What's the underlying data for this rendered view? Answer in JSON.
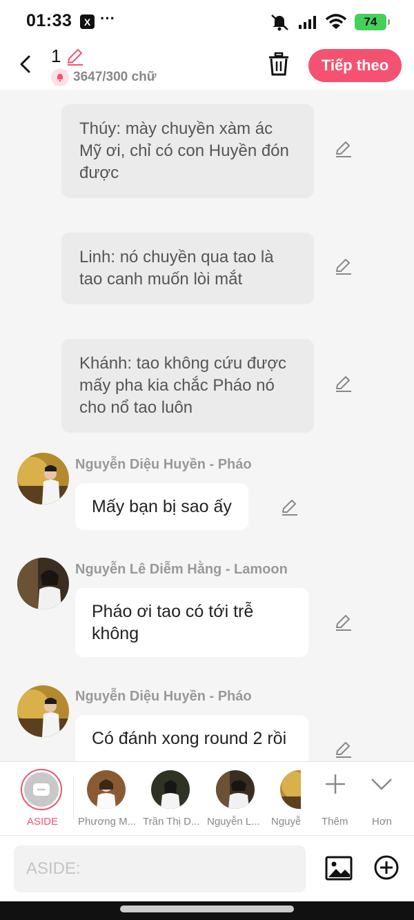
{
  "status_bar": {
    "time": "01:33",
    "x_app": "X",
    "more": "···",
    "battery": "74"
  },
  "header": {
    "title": "1",
    "word_count": "3647/300 chữ",
    "next_label": "Tiếp theo"
  },
  "messages": [
    {
      "type": "narration",
      "text": "Thúy: mày chuyền xàm ác Mỹ ơi, chỉ có con Huyền đón được"
    },
    {
      "type": "narration",
      "text": "Linh: nó chuyền qua tao là tao canh muốn lòi mắt"
    },
    {
      "type": "narration",
      "text": "Khánh: tao không cứu được mấy pha kia chắc Pháo nó cho nổ tao luôn"
    },
    {
      "type": "character",
      "sender": "Nguyễn Diệu Huyền - Pháo",
      "text": "Mấy bạn bị sao ấy"
    },
    {
      "type": "character",
      "sender": "Nguyễn Lê Diễm Hằng - Lamoon",
      "text": "Pháo ơi tao có tới trễ không"
    },
    {
      "type": "character",
      "sender": "Nguyễn Diệu Huyền - Pháo",
      "text": "Có đánh xong round 2 rồi"
    }
  ],
  "characters": {
    "aside_label": "ASIDE",
    "items": [
      {
        "label": "Phương M..."
      },
      {
        "label": "Trần Thị D..."
      },
      {
        "label": "Nguyễn L..."
      },
      {
        "label": "Nguyễ"
      }
    ],
    "add_label": "Thêm",
    "more_label": "Hơn"
  },
  "input": {
    "placeholder": "ASIDE:"
  },
  "colors": {
    "accent": "#f55271",
    "narration_bg": "#ebebeb",
    "bubble_bg": "#ffffff"
  }
}
